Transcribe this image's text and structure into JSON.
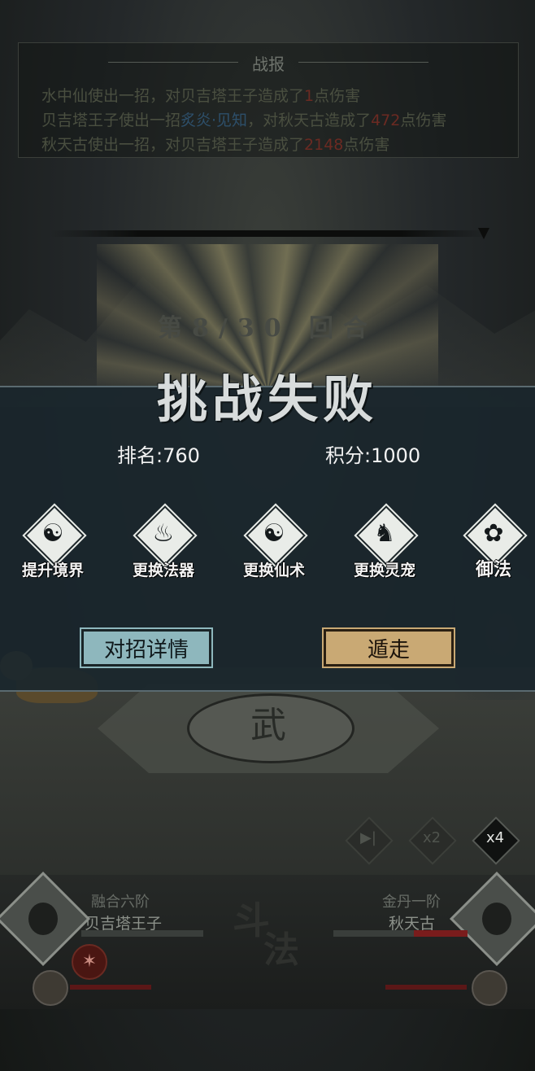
{
  "battle_log": {
    "title": "战报",
    "entries": [
      {
        "prefix": "水中仙使出一招，对贝吉塔王子造成了",
        "skill": "",
        "damage": "1",
        "suffix": "点伤害"
      },
      {
        "prefix": "贝吉塔王子使出一招",
        "skill": "炙炎·见知",
        "middle": "，对秋天古造成了",
        "damage": "472",
        "suffix": "点伤害"
      },
      {
        "prefix": "秋天古使出一招，对贝吉塔王子造成了",
        "skill": "",
        "damage": "2148",
        "suffix": "点伤害"
      }
    ]
  },
  "round": {
    "label": "第8/30 回合"
  },
  "result": {
    "title": "挑战失败",
    "rank": "排名:760",
    "score": "积分:1000"
  },
  "options": [
    {
      "label": "提升境界",
      "icon": "mouse-icon",
      "glyph": "☯"
    },
    {
      "label": "更换法器",
      "icon": "gourd-icon",
      "glyph": "♨"
    },
    {
      "label": "更换仙术",
      "icon": "yinyang-icon",
      "glyph": "☯"
    },
    {
      "label": "更换灵宠",
      "icon": "dragon-icon",
      "glyph": "♞"
    },
    {
      "label": "御法",
      "icon": "flower-icon",
      "glyph": "✿"
    }
  ],
  "buttons": {
    "detail": "对招详情",
    "flee": "遁走"
  },
  "speed": {
    "skip": "▶|",
    "x2": "x2",
    "x4": "x4"
  },
  "fighters": {
    "left": {
      "realm": "融合六阶",
      "name": "贝吉塔王子",
      "hp_fraction": 0.0
    },
    "right": {
      "realm": "金丹一阶",
      "name": "秋天古",
      "hp_fraction": 0.4
    }
  },
  "center_label": {
    "c1": "斗",
    "c2": "法"
  },
  "arena_glyph": "武",
  "colors": {
    "dialog_bg": "#1a262c",
    "detail_button": "#8eb7bd",
    "flee_button": "#c9a974",
    "damage_red": "#6b2a22"
  }
}
